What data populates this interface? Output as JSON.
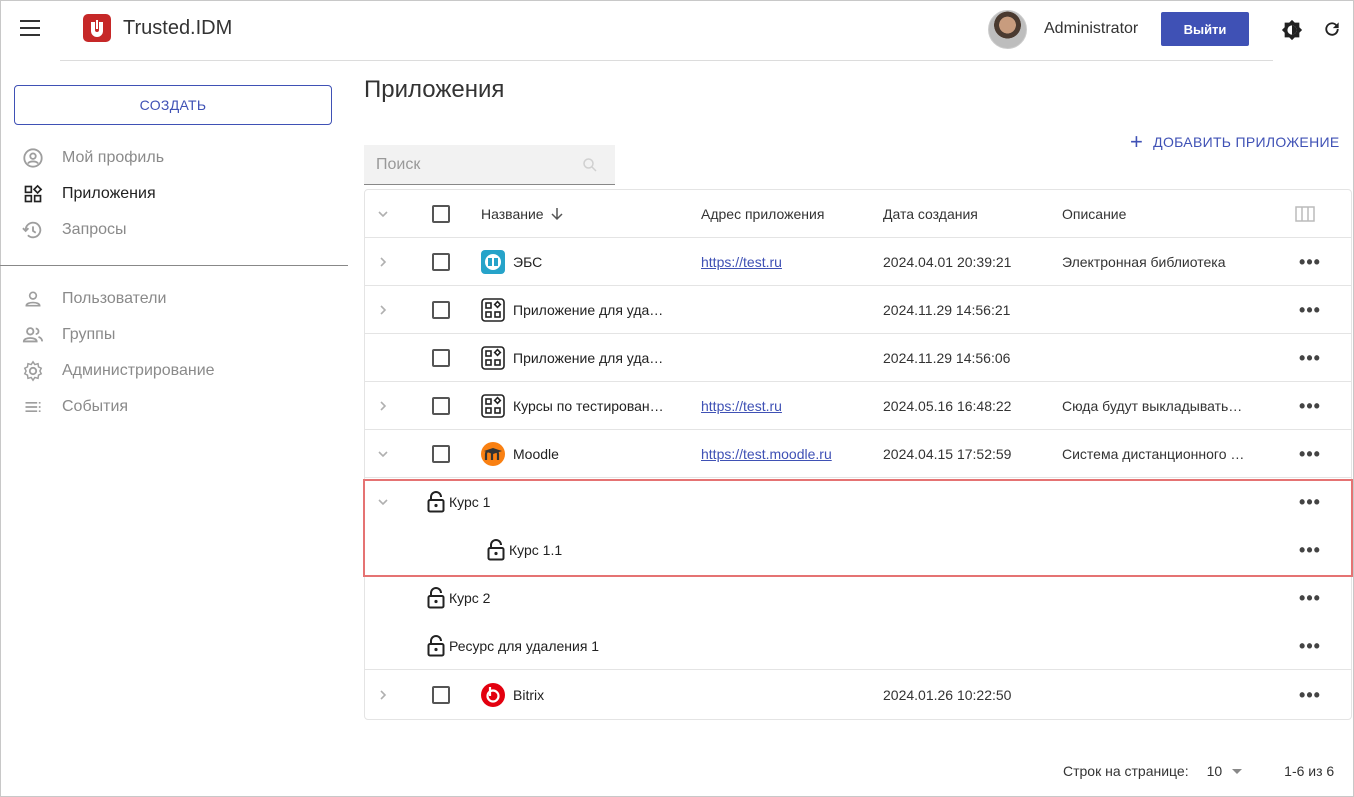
{
  "app": {
    "title": "Trusted.IDM"
  },
  "user": {
    "name": "Administrator",
    "logout_label": "Выйти"
  },
  "sidebar": {
    "create_label": "СОЗДАТЬ",
    "items": [
      {
        "label": "Мой профиль",
        "icon": "account-circle-icon"
      },
      {
        "label": "Приложения",
        "icon": "apps-icon"
      },
      {
        "label": "Запросы",
        "icon": "history-icon"
      },
      {
        "label": "Пользователи",
        "icon": "person-icon"
      },
      {
        "label": "Группы",
        "icon": "group-icon"
      },
      {
        "label": "Администрирование",
        "icon": "gear-icon"
      },
      {
        "label": "События",
        "icon": "list-icon"
      }
    ]
  },
  "main": {
    "title": "Приложения",
    "add_label": "ДОБАВИТЬ ПРИЛОЖЕНИЕ",
    "search_placeholder": "Поиск",
    "columns": {
      "name": "Название",
      "address": "Адрес приложения",
      "date": "Дата создания",
      "description": "Описание"
    },
    "rows": [
      {
        "name": "ЭБС",
        "address": "https://test.ru",
        "date": "2024.04.01 20:39:21",
        "description": "Электронная библиотека",
        "icon": "book-icon"
      },
      {
        "name": "Приложение для уда…",
        "address": "",
        "date": "2024.11.29 14:56:21",
        "description": "",
        "icon": "apps-icon"
      },
      {
        "name": "Приложение для уда…",
        "address": "",
        "date": "2024.11.29 14:56:06",
        "description": "",
        "icon": "apps-icon"
      },
      {
        "name": "Курсы по тестирован…",
        "address": "https://test.ru",
        "date": "2024.05.16 16:48:22",
        "description": "Сюда будут выкладывать…",
        "icon": "apps-icon"
      },
      {
        "name": "Moodle",
        "address": "https://test.moodle.ru",
        "date": "2024.04.15 17:52:59",
        "description": "Система дистанционного …",
        "icon": "moodle-icon"
      },
      {
        "name": "Bitrix",
        "address": "",
        "date": "2024.01.26 10:22:50",
        "description": "",
        "icon": "bitrix-icon"
      }
    ],
    "resources": [
      {
        "name": "Курс 1"
      },
      {
        "name": "Курс 1.1"
      },
      {
        "name": "Курс 2"
      },
      {
        "name": "Ресурс для удаления 1"
      }
    ]
  },
  "pagination": {
    "rows_label": "Строк на странице:",
    "rows_value": "10",
    "range": "1-6 из 6"
  },
  "colors": {
    "accent": "#3f51b5",
    "brand": "#c62828",
    "highlight": "#e57373"
  }
}
